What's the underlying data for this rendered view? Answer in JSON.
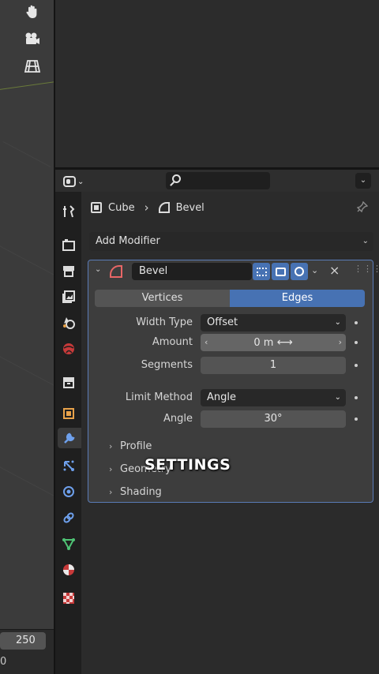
{
  "viewport": {
    "tools": [
      "hand-icon",
      "camera-icon",
      "grid-icon"
    ],
    "timeline_end_frame": "250",
    "timeline_current": "0"
  },
  "properties": {
    "tabs": [
      "tool-icon",
      "render-icon",
      "output-icon",
      "view-layer-icon",
      "scene-icon",
      "world-icon",
      "collection-icon",
      "object-icon",
      "modifier-icon",
      "particles-icon",
      "physics-icon",
      "constraints-icon",
      "data-icon",
      "material-icon",
      "texture-icon"
    ],
    "active_tab": "modifier-icon",
    "breadcrumb": {
      "object": "Cube",
      "modifier": "Bevel"
    },
    "add_modifier_label": "Add Modifier",
    "modifier": {
      "name": "Bevel",
      "affect_options": [
        "Vertices",
        "Edges"
      ],
      "affect_selected": "Edges",
      "width_type_label": "Width Type",
      "width_type_value": "Offset",
      "amount_label": "Amount",
      "amount_value": "0 m",
      "segments_label": "Segments",
      "segments_value": "1",
      "limit_method_label": "Limit Method",
      "limit_method_value": "Angle",
      "angle_label": "Angle",
      "angle_value": "30°",
      "subpanels": [
        "Profile",
        "Geometry",
        "Shading"
      ]
    }
  },
  "caption": "SETTINGS",
  "colors": {
    "accent": "#4772b3",
    "panel_outline": "#5a7bb7",
    "modifier_icon": "#e86666"
  }
}
